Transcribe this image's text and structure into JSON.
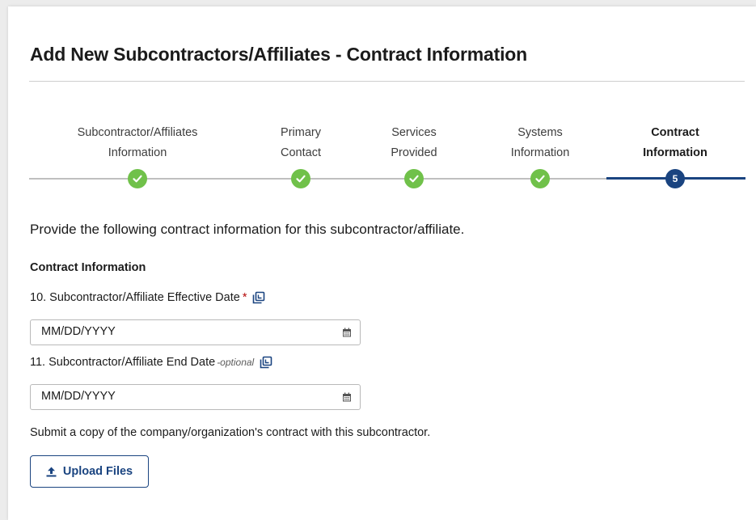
{
  "page": {
    "title": "Add New Subcontractors/Affiliates - Contract Information"
  },
  "stepper": {
    "steps": [
      {
        "label_line1": "Subcontractor/Affiliates",
        "label_line2": "Information",
        "status": "complete",
        "icon": "check-icon"
      },
      {
        "label_line1": "Primary",
        "label_line2": "Contact",
        "status": "complete",
        "icon": "check-icon"
      },
      {
        "label_line1": "Services",
        "label_line2": "Provided",
        "status": "complete",
        "icon": "check-icon"
      },
      {
        "label_line1": "Systems",
        "label_line2": "Information",
        "status": "complete",
        "icon": "check-icon"
      },
      {
        "label_line1": "Contract",
        "label_line2": "Information",
        "status": "current",
        "number": "5"
      }
    ]
  },
  "form": {
    "intro": "Provide the following contract information for this subcontractor/affiliate.",
    "section_heading": "Contract Information",
    "effective_date": {
      "label": "10. Subcontractor/Affiliate Effective Date",
      "required_marker": "*",
      "placeholder": "MM/DD/YYYY",
      "icon": "copy-icon"
    },
    "end_date": {
      "label": "11. Subcontractor/Affiliate End Date",
      "optional_marker": "-optional",
      "placeholder": "MM/DD/YYYY",
      "icon": "copy-icon"
    },
    "submit_text": "Submit a copy of the company/organization's contract with this subcontractor.",
    "upload_button": "Upload Files"
  },
  "colors": {
    "primary": "#1a4480",
    "complete": "#70c14a",
    "required": "#b50909"
  }
}
